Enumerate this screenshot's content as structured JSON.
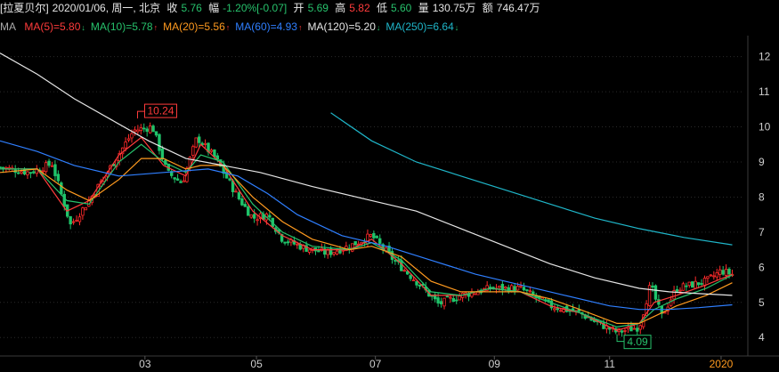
{
  "header": {
    "name": "[拉夏贝尔]",
    "date": "2020/01/06, 周一, 北京",
    "close_label": "收",
    "close_value": "5.76",
    "change_label": "幅",
    "change_value": "-1.20%[-0.07]",
    "open_label": "开",
    "open_value": "5.69",
    "high_label": "高",
    "high_value": "5.82",
    "low_label": "低",
    "low_value": "5.60",
    "volume_label": "量",
    "volume_value": "130.75万",
    "amount_label": "额",
    "amount_value": "746.47万"
  },
  "ma_legend": {
    "prefix": "MA",
    "items": [
      {
        "label": "MA(5)=5.80",
        "color": "#ff3b3b",
        "arrow": "down"
      },
      {
        "label": "MA(10)=5.78",
        "color": "#27c26c",
        "arrow": "up"
      },
      {
        "label": "MA(20)=5.56",
        "color": "#ff9a1f",
        "arrow": "up"
      },
      {
        "label": "MA(60)=4.93",
        "color": "#2f7fff",
        "arrow": "up"
      },
      {
        "label": "MA(120)=5.20",
        "color": "#e6e6e6",
        "arrow": "down"
      },
      {
        "label": "MA(250)=6.64",
        "color": "#1fb6c9",
        "arrow": "down"
      }
    ]
  },
  "colors": {
    "up": "#ff2a2a",
    "down": "#1fc46a",
    "background": "#000000",
    "grid": "#2a2a2a"
  },
  "chart_data": {
    "type": "line",
    "ylim": [
      3.6,
      12.6
    ],
    "y_ticks": [
      4,
      5,
      6,
      7,
      8,
      9,
      10,
      11,
      12
    ],
    "x_tick_labels": [
      {
        "label": "03",
        "t": 0.195
      },
      {
        "label": "05",
        "t": 0.345
      },
      {
        "label": "07",
        "t": 0.505
      },
      {
        "label": "09",
        "t": 0.665
      },
      {
        "label": "11",
        "t": 0.82
      },
      {
        "label": "2020",
        "t": 0.97,
        "highlight": true
      }
    ],
    "annotations": [
      {
        "label": "10.24",
        "type": "high",
        "t": 0.185,
        "value": 10.24
      },
      {
        "label": "4.09",
        "type": "low",
        "t": 0.83,
        "value": 4.09
      }
    ],
    "price_path": [
      [
        0.0,
        8.85
      ],
      [
        0.04,
        8.7
      ],
      [
        0.07,
        8.95
      ],
      [
        0.095,
        7.2
      ],
      [
        0.12,
        7.9
      ],
      [
        0.15,
        8.9
      ],
      [
        0.18,
        9.9
      ],
      [
        0.205,
        10.0
      ],
      [
        0.225,
        8.7
      ],
      [
        0.245,
        8.4
      ],
      [
        0.265,
        9.7
      ],
      [
        0.29,
        9.1
      ],
      [
        0.32,
        8.0
      ],
      [
        0.34,
        7.4
      ],
      [
        0.36,
        7.5
      ],
      [
        0.38,
        6.8
      ],
      [
        0.41,
        6.55
      ],
      [
        0.44,
        6.4
      ],
      [
        0.47,
        6.6
      ],
      [
        0.5,
        6.9
      ],
      [
        0.53,
        6.2
      ],
      [
        0.56,
        5.6
      ],
      [
        0.59,
        4.95
      ],
      [
        0.62,
        5.2
      ],
      [
        0.66,
        5.4
      ],
      [
        0.7,
        5.4
      ],
      [
        0.74,
        4.9
      ],
      [
        0.78,
        4.7
      ],
      [
        0.8,
        4.45
      ],
      [
        0.83,
        4.15
      ],
      [
        0.86,
        4.3
      ],
      [
        0.875,
        5.5
      ],
      [
        0.89,
        4.6
      ],
      [
        0.91,
        5.4
      ],
      [
        0.93,
        5.5
      ],
      [
        0.95,
        5.6
      ],
      [
        0.97,
        5.9
      ],
      [
        0.985,
        5.8
      ]
    ],
    "series": [
      {
        "name": "MA(5)",
        "color": "#ff3b3b",
        "points": [
          [
            0,
            8.8
          ],
          [
            0.05,
            8.8
          ],
          [
            0.09,
            7.6
          ],
          [
            0.12,
            7.9
          ],
          [
            0.16,
            9.2
          ],
          [
            0.19,
            9.7
          ],
          [
            0.22,
            8.9
          ],
          [
            0.25,
            8.6
          ],
          [
            0.27,
            9.5
          ],
          [
            0.3,
            8.9
          ],
          [
            0.34,
            7.6
          ],
          [
            0.38,
            6.9
          ],
          [
            0.42,
            6.5
          ],
          [
            0.47,
            6.5
          ],
          [
            0.5,
            6.8
          ],
          [
            0.54,
            6.1
          ],
          [
            0.58,
            5.2
          ],
          [
            0.62,
            5.2
          ],
          [
            0.66,
            5.4
          ],
          [
            0.7,
            5.3
          ],
          [
            0.74,
            4.9
          ],
          [
            0.78,
            4.7
          ],
          [
            0.83,
            4.2
          ],
          [
            0.86,
            4.4
          ],
          [
            0.88,
            5.0
          ],
          [
            0.91,
            5.2
          ],
          [
            0.95,
            5.5
          ],
          [
            0.985,
            5.8
          ]
        ]
      },
      {
        "name": "MA(10)",
        "color": "#27c26c",
        "points": [
          [
            0,
            8.8
          ],
          [
            0.05,
            8.8
          ],
          [
            0.09,
            7.9
          ],
          [
            0.12,
            7.8
          ],
          [
            0.16,
            9.0
          ],
          [
            0.19,
            9.5
          ],
          [
            0.22,
            9.0
          ],
          [
            0.25,
            8.7
          ],
          [
            0.27,
            9.2
          ],
          [
            0.3,
            9.0
          ],
          [
            0.34,
            7.8
          ],
          [
            0.38,
            7.0
          ],
          [
            0.42,
            6.6
          ],
          [
            0.47,
            6.5
          ],
          [
            0.5,
            6.7
          ],
          [
            0.54,
            6.2
          ],
          [
            0.58,
            5.3
          ],
          [
            0.62,
            5.2
          ],
          [
            0.66,
            5.4
          ],
          [
            0.7,
            5.3
          ],
          [
            0.74,
            5.0
          ],
          [
            0.78,
            4.7
          ],
          [
            0.83,
            4.3
          ],
          [
            0.86,
            4.4
          ],
          [
            0.88,
            4.8
          ],
          [
            0.91,
            5.1
          ],
          [
            0.95,
            5.4
          ],
          [
            0.985,
            5.78
          ]
        ]
      },
      {
        "name": "MA(20)",
        "color": "#ff9a1f",
        "points": [
          [
            0,
            8.7
          ],
          [
            0.05,
            8.8
          ],
          [
            0.09,
            8.2
          ],
          [
            0.12,
            7.9
          ],
          [
            0.16,
            8.5
          ],
          [
            0.19,
            9.1
          ],
          [
            0.22,
            9.1
          ],
          [
            0.25,
            8.8
          ],
          [
            0.27,
            8.9
          ],
          [
            0.3,
            8.9
          ],
          [
            0.34,
            8.0
          ],
          [
            0.38,
            7.3
          ],
          [
            0.42,
            6.8
          ],
          [
            0.47,
            6.5
          ],
          [
            0.5,
            6.6
          ],
          [
            0.54,
            6.3
          ],
          [
            0.58,
            5.6
          ],
          [
            0.62,
            5.3
          ],
          [
            0.66,
            5.3
          ],
          [
            0.7,
            5.3
          ],
          [
            0.74,
            5.1
          ],
          [
            0.78,
            4.8
          ],
          [
            0.83,
            4.4
          ],
          [
            0.86,
            4.4
          ],
          [
            0.88,
            4.6
          ],
          [
            0.91,
            4.9
          ],
          [
            0.95,
            5.2
          ],
          [
            0.985,
            5.56
          ]
        ]
      },
      {
        "name": "MA(60)",
        "color": "#2f7fff",
        "points": [
          [
            0,
            9.6
          ],
          [
            0.05,
            9.3
          ],
          [
            0.1,
            8.9
          ],
          [
            0.16,
            8.6
          ],
          [
            0.22,
            8.7
          ],
          [
            0.28,
            8.8
          ],
          [
            0.32,
            8.6
          ],
          [
            0.36,
            8.1
          ],
          [
            0.4,
            7.5
          ],
          [
            0.46,
            6.9
          ],
          [
            0.52,
            6.6
          ],
          [
            0.58,
            6.2
          ],
          [
            0.64,
            5.8
          ],
          [
            0.7,
            5.5
          ],
          [
            0.76,
            5.2
          ],
          [
            0.82,
            4.9
          ],
          [
            0.86,
            4.8
          ],
          [
            0.9,
            4.8
          ],
          [
            0.94,
            4.85
          ],
          [
            0.985,
            4.93
          ]
        ]
      },
      {
        "name": "MA(120)",
        "color": "#e6e6e6",
        "points": [
          [
            0,
            12.1
          ],
          [
            0.05,
            11.5
          ],
          [
            0.1,
            10.8
          ],
          [
            0.15,
            10.2
          ],
          [
            0.2,
            9.6
          ],
          [
            0.25,
            9.1
          ],
          [
            0.3,
            8.9
          ],
          [
            0.35,
            8.7
          ],
          [
            0.42,
            8.3
          ],
          [
            0.5,
            7.9
          ],
          [
            0.56,
            7.6
          ],
          [
            0.62,
            7.1
          ],
          [
            0.68,
            6.6
          ],
          [
            0.74,
            6.1
          ],
          [
            0.8,
            5.7
          ],
          [
            0.86,
            5.4
          ],
          [
            0.9,
            5.3
          ],
          [
            0.94,
            5.25
          ],
          [
            0.985,
            5.2
          ]
        ]
      },
      {
        "name": "MA(250)",
        "color": "#1fb6c9",
        "points": [
          [
            0.445,
            10.4
          ],
          [
            0.5,
            9.6
          ],
          [
            0.56,
            9.0
          ],
          [
            0.62,
            8.6
          ],
          [
            0.68,
            8.2
          ],
          [
            0.74,
            7.8
          ],
          [
            0.8,
            7.4
          ],
          [
            0.86,
            7.1
          ],
          [
            0.92,
            6.85
          ],
          [
            0.985,
            6.64
          ]
        ]
      }
    ]
  }
}
